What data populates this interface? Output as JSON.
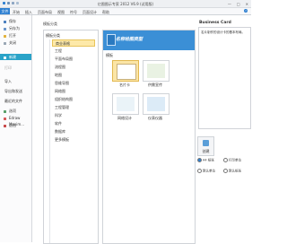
{
  "window": {
    "title": "亿图图示专家 2012 V6.9 (试用版)",
    "controls": [
      "—",
      "□",
      "✕"
    ]
  },
  "ribbon": {
    "tabs": [
      "文件",
      "开始",
      "插入",
      "页面布局",
      "视图",
      "符号",
      "页面设计",
      "帮助"
    ]
  },
  "nav": {
    "items": [
      {
        "label": "保存",
        "icon": "save-icon"
      },
      {
        "label": "另存为",
        "icon": "save-as-icon"
      },
      {
        "label": "打开",
        "icon": "open-folder-icon"
      },
      {
        "label": "关闭",
        "icon": "close-doc-icon"
      },
      {
        "label": "新建",
        "icon": "new-doc-icon"
      },
      {
        "label": "打印",
        "icon": "print-icon"
      },
      {
        "label": "导入",
        "icon": ""
      },
      {
        "label": "导出和发送",
        "icon": ""
      },
      {
        "label": "最近的文件",
        "icon": ""
      },
      {
        "label": "选项",
        "icon": "options-icon"
      },
      {
        "label": "Edraw Maxim...",
        "icon": "edraw-icon"
      },
      {
        "label": "退出",
        "icon": "exit-icon"
      }
    ]
  },
  "templates": {
    "header": "模板分类",
    "categories_header": "模板分类",
    "categories": [
      "商业表格",
      "工程",
      "平面布局图",
      "流程图",
      "地图",
      "思维导图",
      "网络图",
      "组织结构图",
      "工程管理",
      "科学",
      "软件",
      "数据库",
      "更多模板"
    ],
    "selected_category": "商业表格",
    "banner_heading": "名称绘图类型",
    "section_label": "模板",
    "items": [
      {
        "label": "名片卡",
        "icon": "business-card-icon"
      },
      {
        "label": "供需宣传",
        "icon": "flyer-icon"
      },
      {
        "label": "网络设计",
        "icon": "network-design-icon"
      },
      {
        "label": "仪表仪器",
        "icon": "dashboard-icon"
      }
    ]
  },
  "details": {
    "title": "Business Card",
    "description": "名片制作的设计卡的基本布局。",
    "create_label": "创建",
    "options": [
      "A4 纸张",
      "打印单位",
      "默认单位",
      "默认纸张"
    ]
  },
  "colors": {
    "accent": "#2aa3c8",
    "file_tab": "#2d7fd1",
    "banner": "#3b8fd6",
    "selected": "#fde9a9"
  }
}
